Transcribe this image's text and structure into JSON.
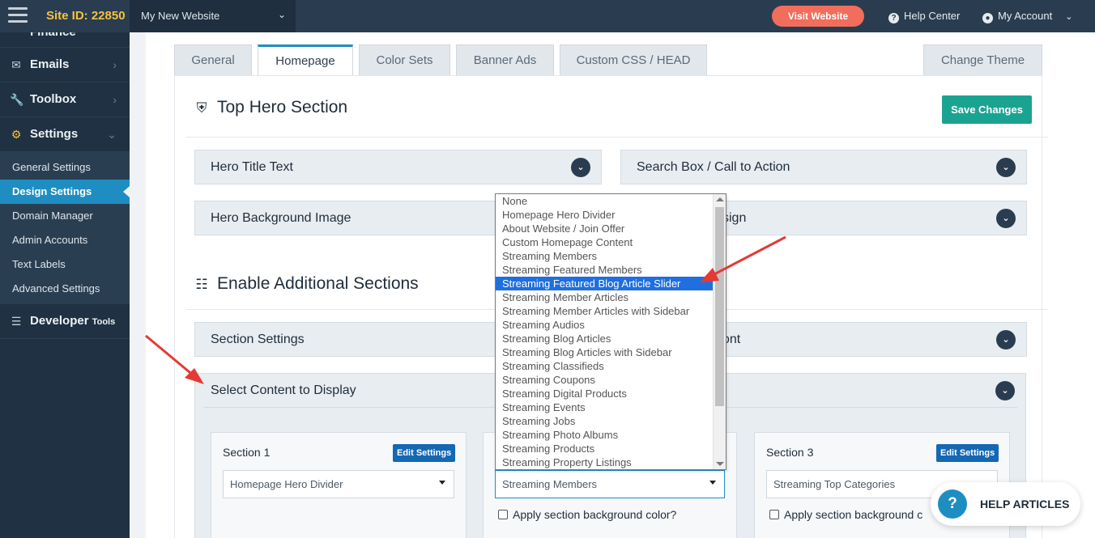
{
  "topbar": {
    "site_id": "Site ID: 22850",
    "site_select": "My New Website",
    "visit_button": "Visit Website",
    "help_center": "Help Center",
    "my_account": "My Account"
  },
  "sidebar": {
    "cut_item": "Finance",
    "items": [
      {
        "label": "Emails",
        "icon": "envelope-icon"
      },
      {
        "label": "Toolbox",
        "icon": "wrench-icon"
      },
      {
        "label": "Settings",
        "icon": "gear-icon"
      }
    ],
    "sub_items": [
      "General Settings",
      "Design Settings",
      "Domain Manager",
      "Admin Accounts",
      "Text Labels",
      "Advanced Settings"
    ],
    "active_sub": "Design Settings",
    "developer": "Developer",
    "developer_small": "Tools"
  },
  "tabs": [
    "General",
    "Homepage",
    "Color Sets",
    "Banner Ads",
    "Custom CSS / HEAD",
    "Change Theme"
  ],
  "active_tab": "Homepage",
  "hero": {
    "title": "Top Hero Section",
    "save_label": "Save Changes",
    "acc1": "Hero Title Text",
    "acc2": "Search Box / Call to Action",
    "acc3": "Hero Background Image",
    "acc4_partial": "sign"
  },
  "additional": {
    "title": "Enable Additional Sections",
    "acc1": "Section Settings",
    "acc2_partial": "ont",
    "select_header": "Select Content to Display"
  },
  "cards": [
    {
      "title": "Section 1",
      "edit": "Edit Settings",
      "value": "Homepage Hero Divider",
      "checkbox": ""
    },
    {
      "title": "",
      "edit": "",
      "value": "Streaming Members",
      "checkbox": "Apply section background color?"
    },
    {
      "title": "Section 3",
      "edit": "Edit Settings",
      "value": "Streaming Top Categories",
      "checkbox": "Apply section background c"
    }
  ],
  "dropdown": {
    "options": [
      "None",
      "Homepage Hero Divider",
      "About Website / Join Offer",
      "Custom Homepage Content",
      "Streaming Members",
      "Streaming Featured Members",
      "Streaming Featured Blog Article Slider",
      "Streaming Member Articles",
      "Streaming Member Articles with Sidebar",
      "Streaming Audios",
      "Streaming Blog Articles",
      "Streaming Blog Articles with Sidebar",
      "Streaming Classifieds",
      "Streaming Coupons",
      "Streaming Digital Products",
      "Streaming Events",
      "Streaming Jobs",
      "Streaming Photo Albums",
      "Streaming Products",
      "Streaming Property Listings"
    ],
    "selected": "Streaming Featured Blog Article Slider"
  },
  "help_articles": "HELP ARTICLES",
  "colors": {
    "accent": "#1e8ec2",
    "save": "#1ba391",
    "visit": "#f26d5b",
    "arrow": "#e53935"
  }
}
